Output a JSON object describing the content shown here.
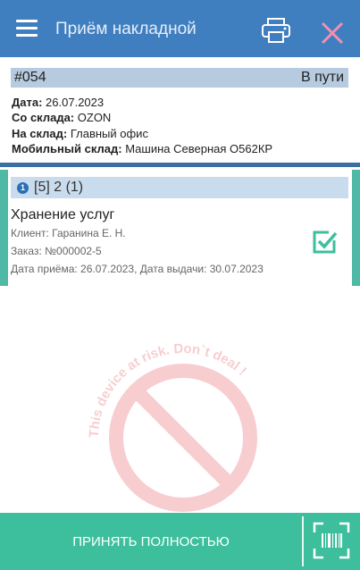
{
  "appbar": {
    "title": "Приём накладной",
    "menu_icon": "hamburger-menu-icon",
    "print_icon": "printer-icon",
    "close_icon": "close-icon",
    "color": "#3f7fc0"
  },
  "document": {
    "number": "#054",
    "status": "В пути",
    "date_label": "Дата:",
    "date_value": "26.07.2023",
    "from_label": "Со склада:",
    "from_value": "OZON",
    "to_label": "На склад:",
    "to_value": "Главный офис",
    "mobile_label": "Мобильный склад:",
    "mobile_value": "Машина Северная О562КР"
  },
  "item": {
    "index": "1",
    "counts": "[5] 2 (1)",
    "title": "Хранение услуг",
    "client": "Клиент: Гаранина Е. Н.",
    "order": "Заказ: №000002-5",
    "dates": "Дата приёма: 26.07.2023, Дата выдачи: 30.07.2023",
    "check_icon": "checkbox-checked-icon",
    "accent": "#4fb9a5"
  },
  "watermark": {
    "text": "This device at risk. Don`t deal !",
    "color": "#e0202a"
  },
  "bottom": {
    "accept_label": "ПРИНЯТЬ ПОЛНОСТЬЮ",
    "scan_icon": "barcode-scan-icon",
    "color": "#3dbf9d"
  }
}
